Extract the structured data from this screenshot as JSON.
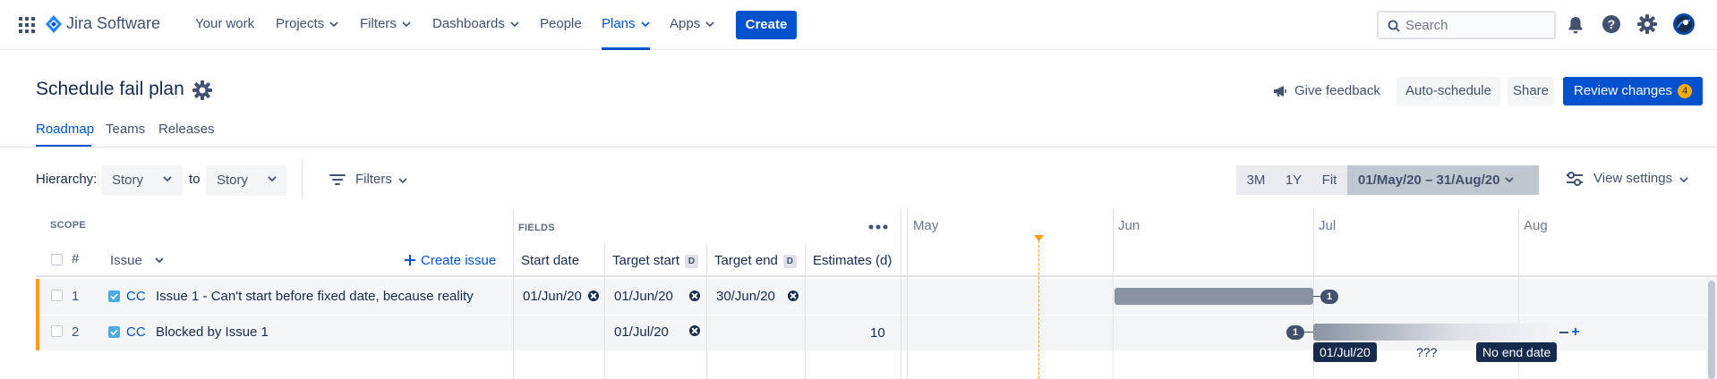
{
  "nav": {
    "product": "Jira Software",
    "items": [
      "Your work",
      "Projects",
      "Filters",
      "Dashboards",
      "People",
      "Plans",
      "Apps"
    ],
    "create_label": "Create",
    "search_placeholder": "Search"
  },
  "header": {
    "title": "Schedule fail plan",
    "give_feedback": "Give feedback",
    "auto_schedule": "Auto-schedule",
    "share": "Share",
    "review_changes": "Review changes",
    "review_count": "4"
  },
  "tabs": [
    "Roadmap",
    "Teams",
    "Releases"
  ],
  "toolbar": {
    "hierarchy_label": "Hierarchy:",
    "hierarchy_from": "Story",
    "to_label": "to",
    "hierarchy_to": "Story",
    "filters": "Filters",
    "range_buttons": [
      "3M",
      "1Y",
      "Fit"
    ],
    "date_range": "01/May/20 – 31/Aug/20",
    "view_settings": "View settings"
  },
  "table": {
    "scope_label": "SCOPE",
    "fields_label": "FIELDS",
    "hash_header": "#",
    "issue_header": "Issue",
    "create_issue": "Create issue",
    "columns": {
      "start_date": "Start date",
      "target_start": "Target start",
      "target_end": "Target end",
      "estimates": "Estimates (d)",
      "d_tag": "D"
    },
    "rows": [
      {
        "num": "1",
        "key": "CC",
        "summary": "Issue 1 - Can't start before fixed date, because reality",
        "start_date": "01/Jun/20",
        "target_start": "01/Jun/20",
        "target_end": "30/Jun/20",
        "estimate": ""
      },
      {
        "num": "2",
        "key": "CC",
        "summary": "Blocked by Issue 1",
        "start_date": "",
        "target_start": "01/Jul/20",
        "target_end": "",
        "estimate": "10"
      }
    ]
  },
  "timeline": {
    "months": [
      "May",
      "Jun",
      "Jul",
      "Aug"
    ],
    "dependency_count_1": "1",
    "dependency_count_2": "1",
    "start_tip": "01/Jul/20",
    "middle_tip": "???",
    "end_tip": "No end date"
  },
  "colors": {
    "accent": "#0052cc",
    "row_marker": "#ff991f",
    "bar": "#8993a4",
    "today_line": "#ff991f"
  }
}
